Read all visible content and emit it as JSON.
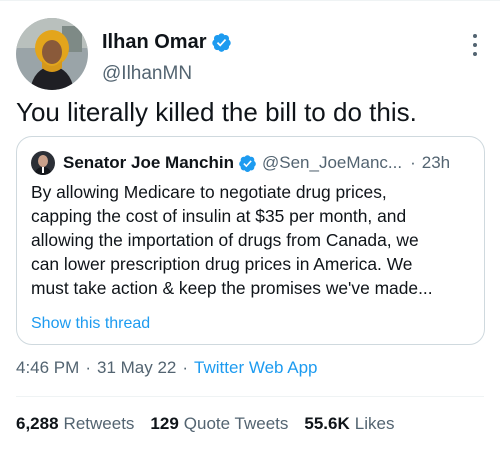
{
  "tweet": {
    "author_name": "Ilhan Omar",
    "author_handle": "@IlhanMN",
    "text": "You literally killed the bill to do this.",
    "time": "4:46 PM",
    "date": "31 May 22",
    "source": "Twitter Web App",
    "separator": "·"
  },
  "quoted_tweet": {
    "author_name": "Senator Joe Manchin",
    "author_handle": "@Sen_JoeManc...",
    "separator": "·",
    "age": "23h",
    "lines": [
      "By allowing Medicare to negotiate drug prices,",
      "capping the cost of insulin at $35 per month, and",
      "allowing the importation of drugs from Canada, we",
      "can lower prescription drug prices in America. We",
      "must take action & keep the promises we've made..."
    ],
    "show_thread": "Show this thread"
  },
  "stats": {
    "retweets_count": "6,288",
    "retweets_label": "Retweets",
    "quotes_count": "129",
    "quotes_label": "Quote Tweets",
    "likes_count": "55.6K",
    "likes_label": "Likes"
  },
  "icons": {
    "verified": "verified-badge-icon",
    "more": "more-options-icon"
  },
  "colors": {
    "accent": "#1d9bf0",
    "text": "#0f1419",
    "secondary": "#536471",
    "border": "#cfd9de"
  }
}
